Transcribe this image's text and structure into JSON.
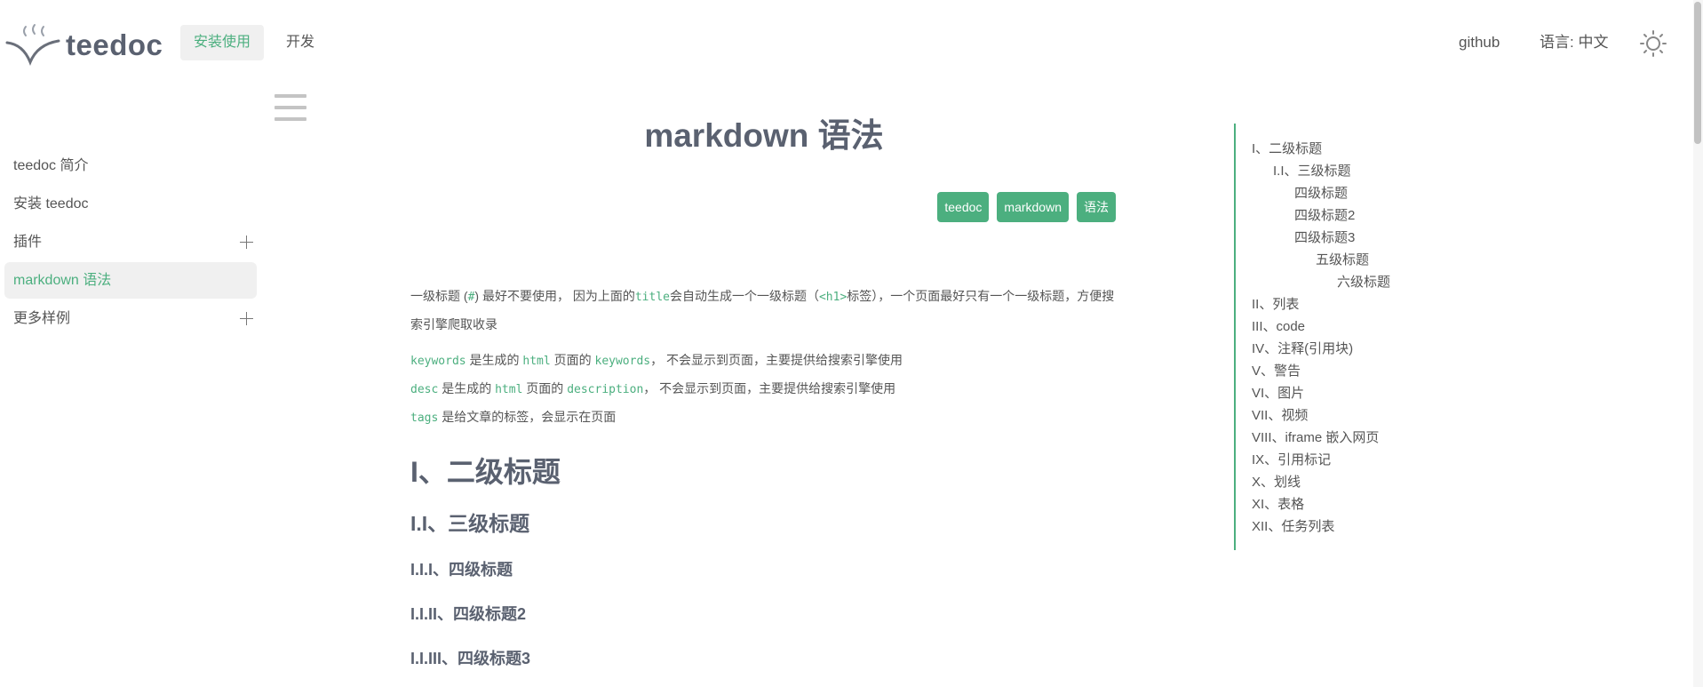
{
  "header": {
    "logo_text": "teedoc",
    "nav": {
      "install": "安装使用",
      "develop": "开发"
    },
    "github": "github",
    "language": "语言: 中文"
  },
  "sidebar": {
    "items": [
      {
        "label": "teedoc 简介"
      },
      {
        "label": "安装 teedoc"
      },
      {
        "label": "插件"
      },
      {
        "label": "markdown 语法"
      },
      {
        "label": "更多样例"
      }
    ]
  },
  "page": {
    "title": "markdown 语法",
    "tags": [
      "teedoc",
      "markdown",
      "语法"
    ],
    "intro": {
      "a": "一级标题 (",
      "b": "#",
      "c": ") 最好不要使用， 因为上面的",
      "d": "title",
      "e": "会自动生成一个一级标题（",
      "f": "<h1>",
      "g": "标签），一个页面最好只有一个一级标题，方便搜索引擎爬取收录"
    },
    "meta": {
      "keywords_code": "keywords",
      "keywords_a": " 是生成的 ",
      "html1": "html",
      "keywords_b": " 页面的 ",
      "keywords_code2": "keywords",
      "keywords_c": "， 不会显示到页面，主要提供给搜索引擎使用",
      "desc_code": "desc",
      "desc_a": " 是生成的 ",
      "html2": "html",
      "desc_b": " 页面的 ",
      "desc_code2": "description",
      "desc_c": "， 不会显示到页面，主要提供给搜索引擎使用",
      "tags_code": "tags",
      "tags_a": " 是给文章的标签，会显示在页面"
    },
    "h2": "I、二级标题",
    "h3": "I.I、三级标题",
    "h4_1": "I.I.I、四级标题",
    "h4_2": "I.I.II、四级标题2",
    "h4_3": "I.I.III、四级标题3"
  },
  "toc": [
    {
      "label": "I、二级标题",
      "level": 1
    },
    {
      "label": "I.I、三级标题",
      "level": 2
    },
    {
      "label": "四级标题",
      "level": 3
    },
    {
      "label": "四级标题2",
      "level": 3
    },
    {
      "label": "四级标题3",
      "level": 3
    },
    {
      "label": "五级标题",
      "level": 4
    },
    {
      "label": "六级标题",
      "level": 5
    },
    {
      "label": "II、列表",
      "level": 1
    },
    {
      "label": "III、code",
      "level": 1
    },
    {
      "label": "IV、注释(引用块)",
      "level": 1
    },
    {
      "label": "V、警告",
      "level": 1
    },
    {
      "label": "VI、图片",
      "level": 1
    },
    {
      "label": "VII、视频",
      "level": 1
    },
    {
      "label": "VIII、iframe 嵌入网页",
      "level": 1
    },
    {
      "label": "IX、引用标记",
      "level": 1
    },
    {
      "label": "X、划线",
      "level": 1
    },
    {
      "label": "XI、表格",
      "level": 1
    },
    {
      "label": "XII、任务列表",
      "level": 1
    }
  ],
  "colors": {
    "accent": "#4caf7f",
    "heading": "#5a6170",
    "text": "#555555"
  }
}
